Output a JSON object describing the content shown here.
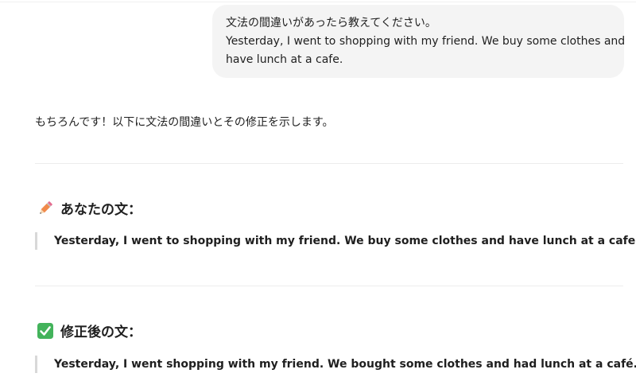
{
  "user_message": {
    "line1": "文法の間違いがあったら教えてください。",
    "line2": "Yesterday, I went to shopping with my friend. We buy some clothes and",
    "line3": "have lunch at a cafe."
  },
  "assistant": {
    "intro": "もちろんです！以下に文法の間違いとその修正を示します。",
    "sections": [
      {
        "icon": "pencil-icon",
        "heading": "あなたの文：",
        "quote": "Yesterday, I went to shopping with my friend. We buy some clothes and have lunch at a cafe."
      },
      {
        "icon": "check-mark-button-icon",
        "heading": "修正後の文：",
        "quote": "Yesterday, I went shopping with my friend. We bought some clothes and had lunch at a café."
      }
    ]
  },
  "colors": {
    "bubble_bg": "#f4f4f4",
    "check_green": "#43b35b",
    "pencil_orange": "#f08a4b"
  }
}
